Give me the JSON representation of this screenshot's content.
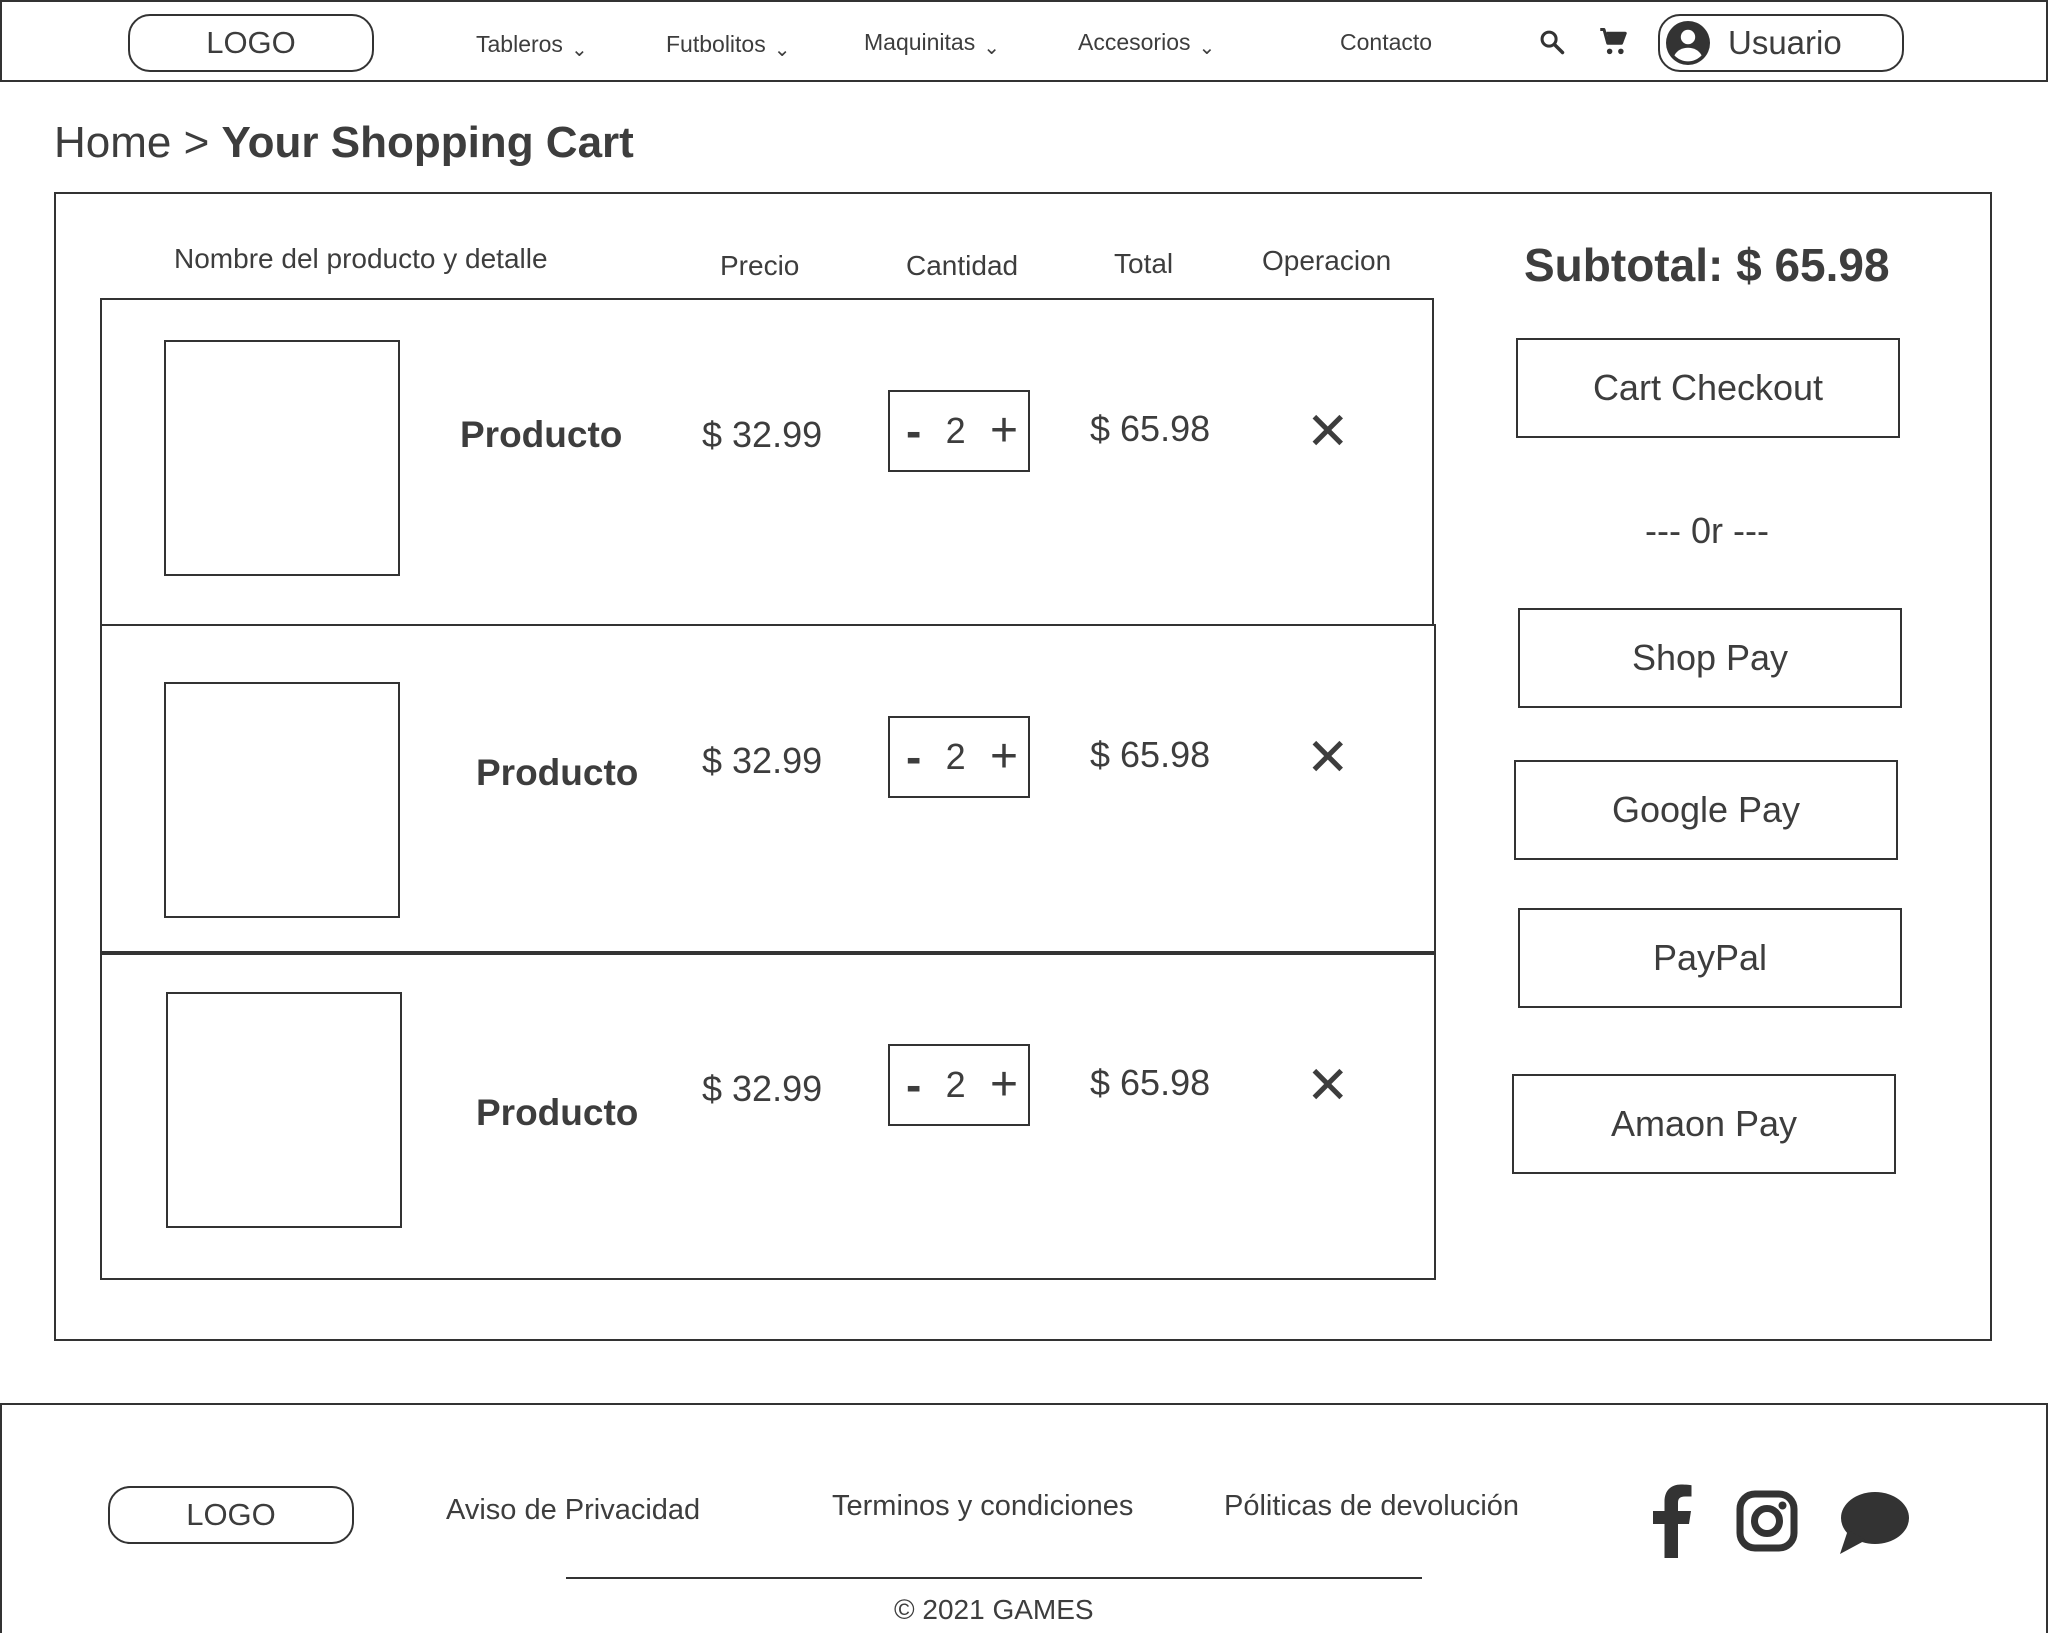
{
  "header": {
    "logo": "LOGO",
    "nav": [
      {
        "label": "Tableros",
        "chevron": "⌄"
      },
      {
        "label": "Futbolitos",
        "chevron": "⌄"
      },
      {
        "label": "Maquinitas",
        "chevron": "⌄"
      },
      {
        "label": "Accesorios",
        "chevron": "⌄"
      },
      {
        "label": "Contacto"
      }
    ],
    "search_icon": "search-icon",
    "cart_icon": "shopping-cart-icon",
    "user_icon": "account-circle-icon",
    "user_label": "Usuario"
  },
  "breadcrumb": {
    "home": "Home",
    "separator": ">",
    "current": "Your Shopping Cart"
  },
  "table": {
    "columns": [
      "Nombre del producto y detalle",
      "Precio",
      "Cantidad",
      "Total",
      "Operacion"
    ],
    "rows": [
      {
        "name": "Producto",
        "price": "$ 32.99",
        "qty_minus": "-",
        "qty": "2",
        "qty_plus": "+",
        "total": "$ 65.98",
        "remove": "✕"
      },
      {
        "name": "Producto",
        "price": "$ 32.99",
        "qty_minus": "-",
        "qty": "2",
        "qty_plus": "+",
        "total": "$ 65.98",
        "remove": "✕"
      },
      {
        "name": "Producto",
        "price": "$ 32.99",
        "qty_minus": "-",
        "qty": "2",
        "qty_plus": "+",
        "total": "$ 65.98",
        "remove": "✕"
      }
    ]
  },
  "summary": {
    "subtotal": "Subtotal: $ 65.98",
    "checkout": "Cart Checkout",
    "or": "--- 0r ---",
    "payments": [
      "Shop Pay",
      "Google Pay",
      "PayPal",
      "Amaon Pay"
    ]
  },
  "footer": {
    "logo": "LOGO",
    "links": [
      "Aviso de Privacidad",
      "Terminos y condiciones",
      "Póliticas de devolución"
    ],
    "social_icons": [
      "facebook-icon",
      "instagram-icon",
      "chat-bubble-icon"
    ],
    "copyright": "© 2021 GAMES"
  },
  "colors": {
    "stroke": "#333333",
    "text": "#3d3d3d",
    "background": "#ffffff"
  }
}
